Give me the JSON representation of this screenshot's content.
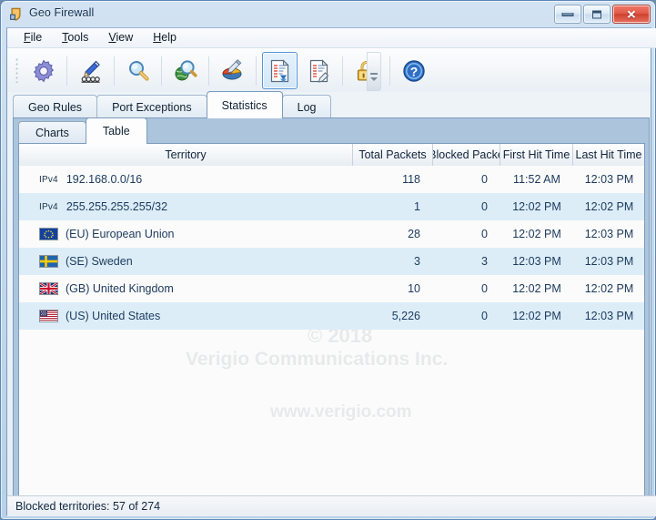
{
  "window": {
    "title": "Geo Firewall",
    "icon": "shield-icon",
    "controls": {
      "minimize": "minimize-button",
      "maximize": "maximize-button",
      "close": "✕"
    }
  },
  "menu": {
    "items": [
      {
        "label": "File",
        "accel": "F"
      },
      {
        "label": "Tools",
        "accel": "T"
      },
      {
        "label": "View",
        "accel": "V"
      },
      {
        "label": "Help",
        "accel": "H"
      }
    ]
  },
  "toolbar": {
    "buttons": [
      {
        "name": "settings-gear-icon",
        "selected": false
      },
      {
        "name": "edit-rules-pencil-icon",
        "selected": false
      },
      {
        "name": "search-magnifier-icon",
        "selected": false
      },
      {
        "name": "geo-lookup-globe-icon",
        "selected": false
      },
      {
        "name": "charts-pie-edit-icon",
        "selected": false
      },
      {
        "name": "statistics-report-icon",
        "selected": true
      },
      {
        "name": "log-report-edit-icon",
        "selected": false
      },
      {
        "name": "unlock-padlock-icon",
        "selected": false
      },
      {
        "name": "help-question-icon",
        "selected": false
      }
    ],
    "overflow": "toolbar-overflow-chevron-icon"
  },
  "tabs": {
    "main": [
      {
        "label": "Geo Rules",
        "active": false
      },
      {
        "label": "Port Exceptions",
        "active": false
      },
      {
        "label": "Statistics",
        "active": true
      },
      {
        "label": "Log",
        "active": false
      }
    ],
    "sub": [
      {
        "label": "Charts",
        "active": false
      },
      {
        "label": "Table",
        "active": true
      }
    ]
  },
  "table": {
    "columns": [
      "Territory",
      "Total Packets",
      "Blocked Packe",
      "First Hit Time",
      "Last Hit Time"
    ],
    "rows": [
      {
        "kind": "ipv4",
        "tag": "IPv4",
        "territory": "192.168.0.0/16",
        "total": "118",
        "blocked": "0",
        "first": "11:52 AM",
        "last": "12:03 PM"
      },
      {
        "kind": "ipv4",
        "tag": "IPv4",
        "territory": "255.255.255.255/32",
        "total": "1",
        "blocked": "0",
        "first": "12:02 PM",
        "last": "12:02 PM"
      },
      {
        "kind": "flag",
        "flag": "eu",
        "territory": "(EU) European Union",
        "total": "28",
        "blocked": "0",
        "first": "12:02 PM",
        "last": "12:03 PM"
      },
      {
        "kind": "flag",
        "flag": "se",
        "territory": "(SE) Sweden",
        "total": "3",
        "blocked": "3",
        "first": "12:03 PM",
        "last": "12:03 PM"
      },
      {
        "kind": "flag",
        "flag": "gb",
        "territory": "(GB) United Kingdom",
        "total": "10",
        "blocked": "0",
        "first": "12:02 PM",
        "last": "12:02 PM"
      },
      {
        "kind": "flag",
        "flag": "us",
        "territory": "(US) United States",
        "total": "5,226",
        "blocked": "0",
        "first": "12:02 PM",
        "last": "12:03 PM"
      }
    ]
  },
  "watermark": {
    "line1": "© 2018",
    "line2": "Verigio Communications Inc.",
    "line3": "www.verigio.com"
  },
  "statusbar": {
    "text": "Blocked territories: 57 of 274"
  },
  "colors": {
    "accent": "#5596d6",
    "row_alt": "#dcedf8",
    "panel_blue": "#acc5dd",
    "text": "#1b3a5c"
  }
}
